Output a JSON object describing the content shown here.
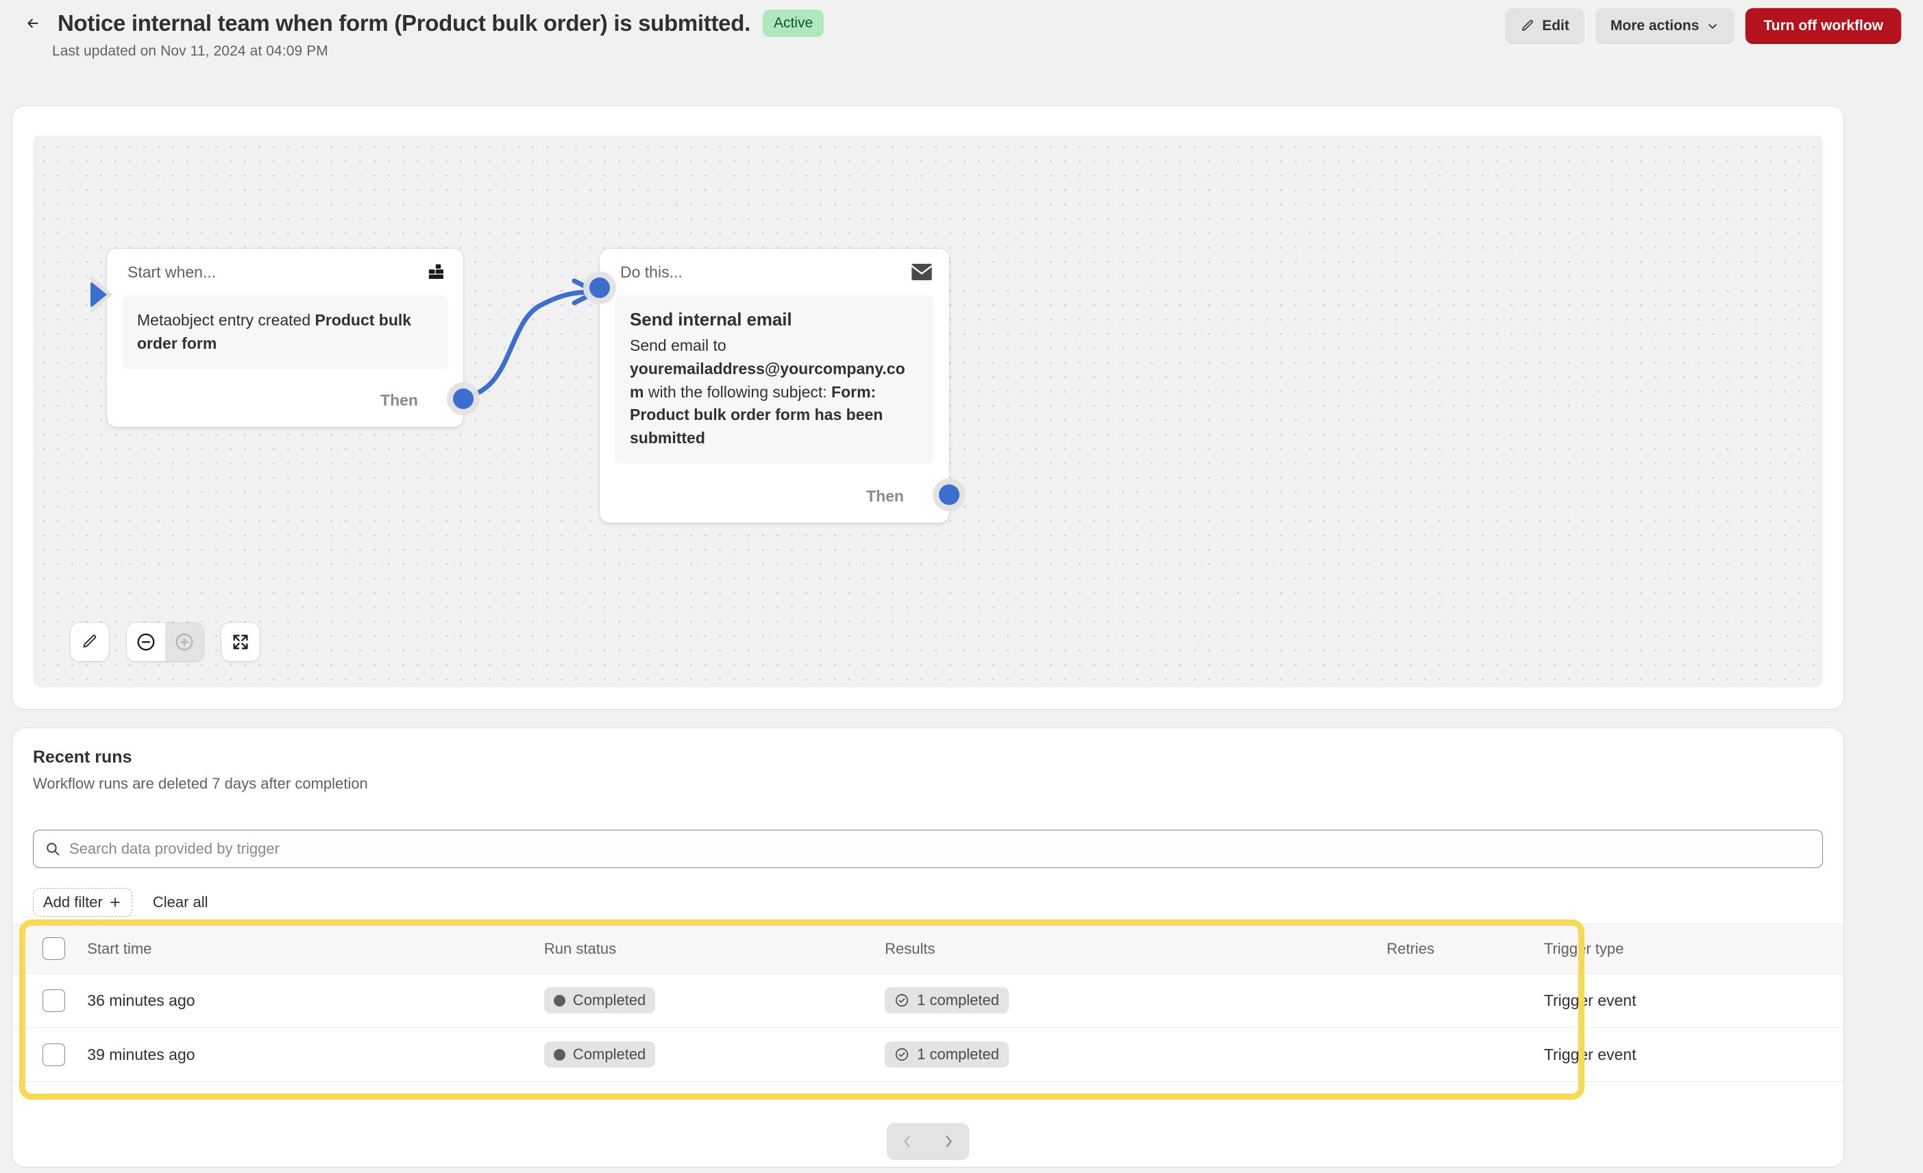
{
  "header": {
    "back_icon": "arrow-left-icon",
    "title": "Notice internal team when form (Product bulk order) is submitted.",
    "status": "Active",
    "subtitle": "Last updated on Nov 11, 2024 at 04:09 PM",
    "edit_label": "Edit",
    "edit_icon": "pencil-icon",
    "more_actions_label": "More actions",
    "more_actions_icon": "chevron-down-icon",
    "turn_off_label": "Turn off workflow",
    "accent_green_bg": "#AFE8BC",
    "accent_green_fg": "#0C5132",
    "critical_red": "#B5121B"
  },
  "canvas": {
    "node_accent": "#3C6ECF",
    "trigger": {
      "head_label": "Start when...",
      "head_icon": "metaobject-blocks-icon",
      "body_text_plain": "Metaobject entry created ",
      "body_text_bold": "Product bulk order form",
      "then_label": "Then"
    },
    "action": {
      "head_label": "Do this...",
      "head_icon": "email-icon",
      "title": "Send internal email",
      "text_1": "Send email to ",
      "text_bold_1": "youremailaddress@yourcompany.com",
      "text_2": " with the following subject: ",
      "text_bold_2": "Form: Product bulk order form has been submitted",
      "then_label": "Then"
    },
    "tools": {
      "edit_icon": "pencil-icon",
      "zoom_out_icon": "minus-circle-icon",
      "zoom_in_icon": "plus-circle-icon",
      "fit_icon": "collapse-arrows-icon"
    }
  },
  "recent_runs": {
    "title": "Recent runs",
    "subtitle": "Workflow runs are deleted 7 days after completion",
    "search_placeholder": "Search data provided by trigger",
    "search_value": "",
    "search_icon": "search-icon",
    "add_filter_label": "Add filter",
    "add_filter_icon": "plus-icon",
    "clear_all_label": "Clear all",
    "columns": [
      "Start time",
      "Run status",
      "Results",
      "Retries",
      "Trigger type"
    ],
    "rows": [
      {
        "start_time": "36 minutes ago",
        "run_status": "Completed",
        "results": "1 completed",
        "retries": "",
        "trigger_type": "Trigger event"
      },
      {
        "start_time": "39 minutes ago",
        "run_status": "Completed",
        "results": "1 completed",
        "retries": "",
        "trigger_type": "Trigger event"
      }
    ],
    "highlight_color": "#F6DA56",
    "pagination": {
      "prev_icon": "chevron-left-icon",
      "next_icon": "chevron-right-icon"
    }
  }
}
